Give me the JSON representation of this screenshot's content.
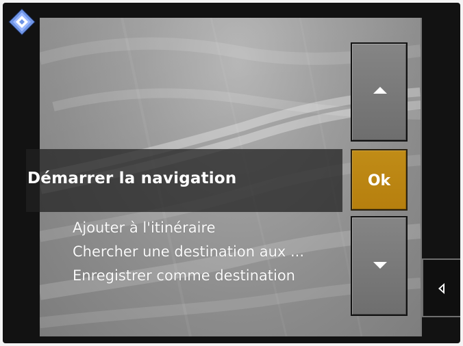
{
  "navigation_menu": {
    "selected_action": "Démarrer la navigation",
    "ok_label": "Ok",
    "items": [
      "Ajouter à l'itinéraire",
      "Chercher  une destination aux ...",
      "Enregistrer comme destination"
    ]
  },
  "controls": {
    "up_icon": "triangle-up-icon",
    "down_icon": "triangle-down-icon",
    "back_icon": "triangle-left-icon",
    "compass_icon": "compass-icon"
  },
  "colors": {
    "frame": "#121212",
    "screen": "#9b9b9b",
    "selection_band": "#222222",
    "ok_button": "#b8820f",
    "compass": "#6f95e6",
    "text": "#ffffff"
  }
}
